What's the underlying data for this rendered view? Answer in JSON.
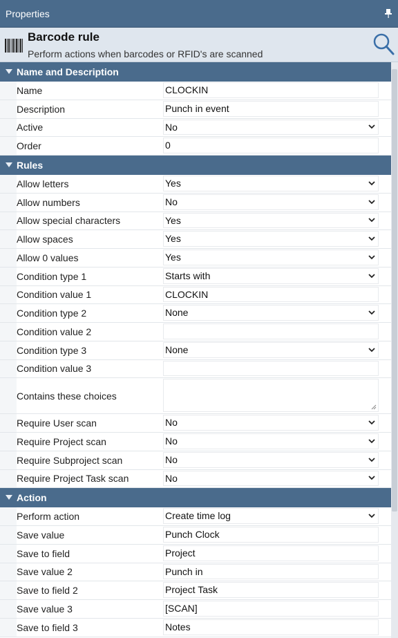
{
  "window": {
    "title": "Properties"
  },
  "header": {
    "title": "Barcode rule",
    "subtitle": "Perform actions when barcodes or RFID's are scanned"
  },
  "sections": [
    {
      "label": "Name and Description",
      "rows": [
        {
          "label": "Name",
          "value": "CLOCKIN",
          "kind": "text"
        },
        {
          "label": "Description",
          "value": "Punch in event",
          "kind": "text"
        },
        {
          "label": "Active",
          "value": "No",
          "kind": "select"
        },
        {
          "label": "Order",
          "value": "0",
          "kind": "text"
        }
      ]
    },
    {
      "label": "Rules",
      "rows": [
        {
          "label": "Allow letters",
          "value": "Yes",
          "kind": "select"
        },
        {
          "label": "Allow numbers",
          "value": "No",
          "kind": "select"
        },
        {
          "label": "Allow special characters",
          "value": "Yes",
          "kind": "select"
        },
        {
          "label": "Allow spaces",
          "value": "Yes",
          "kind": "select"
        },
        {
          "label": "Allow 0 values",
          "value": "Yes",
          "kind": "select"
        },
        {
          "label": "Condition type 1",
          "value": "Starts with",
          "kind": "select"
        },
        {
          "label": "Condition value 1",
          "value": "CLOCKIN",
          "kind": "text"
        },
        {
          "label": "Condition type 2",
          "value": "None",
          "kind": "select"
        },
        {
          "label": "Condition value 2",
          "value": "",
          "kind": "text"
        },
        {
          "label": "Condition type 3",
          "value": "None",
          "kind": "select"
        },
        {
          "label": "Condition value 3",
          "value": "",
          "kind": "text"
        },
        {
          "label": "Contains these choices",
          "value": "",
          "kind": "textarea"
        },
        {
          "label": "Require User scan",
          "value": "No",
          "kind": "select"
        },
        {
          "label": "Require Project scan",
          "value": "No",
          "kind": "select"
        },
        {
          "label": "Require Subproject scan",
          "value": "No",
          "kind": "select"
        },
        {
          "label": "Require Project Task scan",
          "value": "No",
          "kind": "select"
        }
      ]
    },
    {
      "label": "Action",
      "rows": [
        {
          "label": "Perform action",
          "value": "Create time log",
          "kind": "select"
        },
        {
          "label": "Save value",
          "value": "Punch Clock",
          "kind": "text"
        },
        {
          "label": "Save to field",
          "value": "Project",
          "kind": "text"
        },
        {
          "label": "Save value 2",
          "value": "Punch in",
          "kind": "text"
        },
        {
          "label": "Save to field 2",
          "value": "Project Task",
          "kind": "text"
        },
        {
          "label": "Save value 3",
          "value": "[SCAN]",
          "kind": "text"
        },
        {
          "label": "Save to field 3",
          "value": "Notes",
          "kind": "text"
        }
      ]
    }
  ],
  "colors": {
    "accent": "#4a6b8c",
    "header_bg": "#dfe6ee"
  },
  "icons": {
    "pin": "pin-icon",
    "barcode": "barcode-icon",
    "search": "search-icon",
    "caret": "caret-down-icon",
    "chevron": "chevron-down-icon"
  }
}
